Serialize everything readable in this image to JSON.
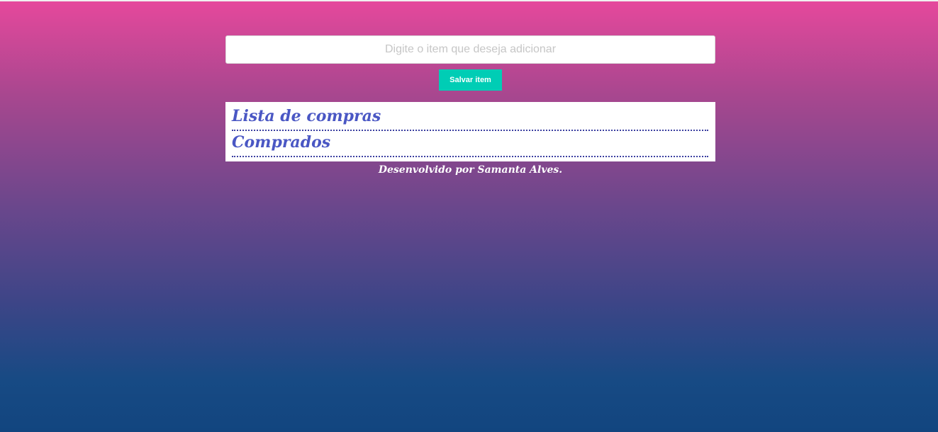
{
  "form": {
    "input_placeholder": "Digite o item que deseja adicionar",
    "input_value": "",
    "save_label": "Salvar item"
  },
  "sections": [
    {
      "title": "Lista de compras",
      "items": []
    },
    {
      "title": "Comprados",
      "items": []
    }
  ],
  "footer": {
    "credit": "Desenvolvido por Samanta Alves."
  },
  "colors": {
    "accent": "#00cdb5",
    "heading": "#4a57c4",
    "gradient_top": "#e6489c",
    "gradient_bottom": "#12457f"
  }
}
